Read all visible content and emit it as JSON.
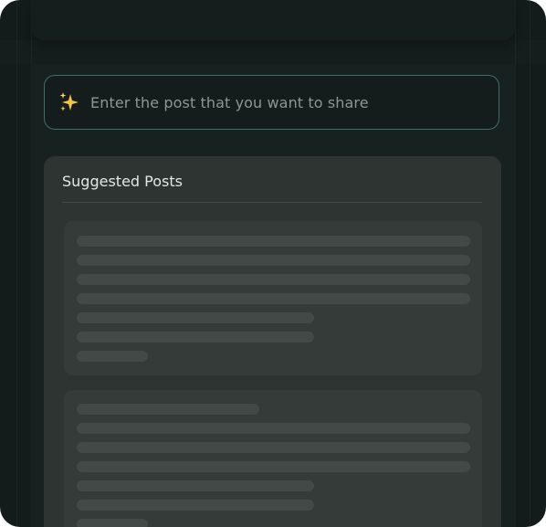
{
  "composer": {
    "icon": "sparkles-icon",
    "placeholder": "Enter the post that you want to share"
  },
  "suggested": {
    "title": "Suggested Posts",
    "cards_loading": 2
  },
  "colors": {
    "background": "#131c1b",
    "composer_border": "#3f6f68",
    "panel": "#2d3432",
    "skeleton_card": "#343b39",
    "skeleton_line": "#424947",
    "sparkle_large": "#f4c542",
    "sparkle_small": "#f7d66b"
  }
}
